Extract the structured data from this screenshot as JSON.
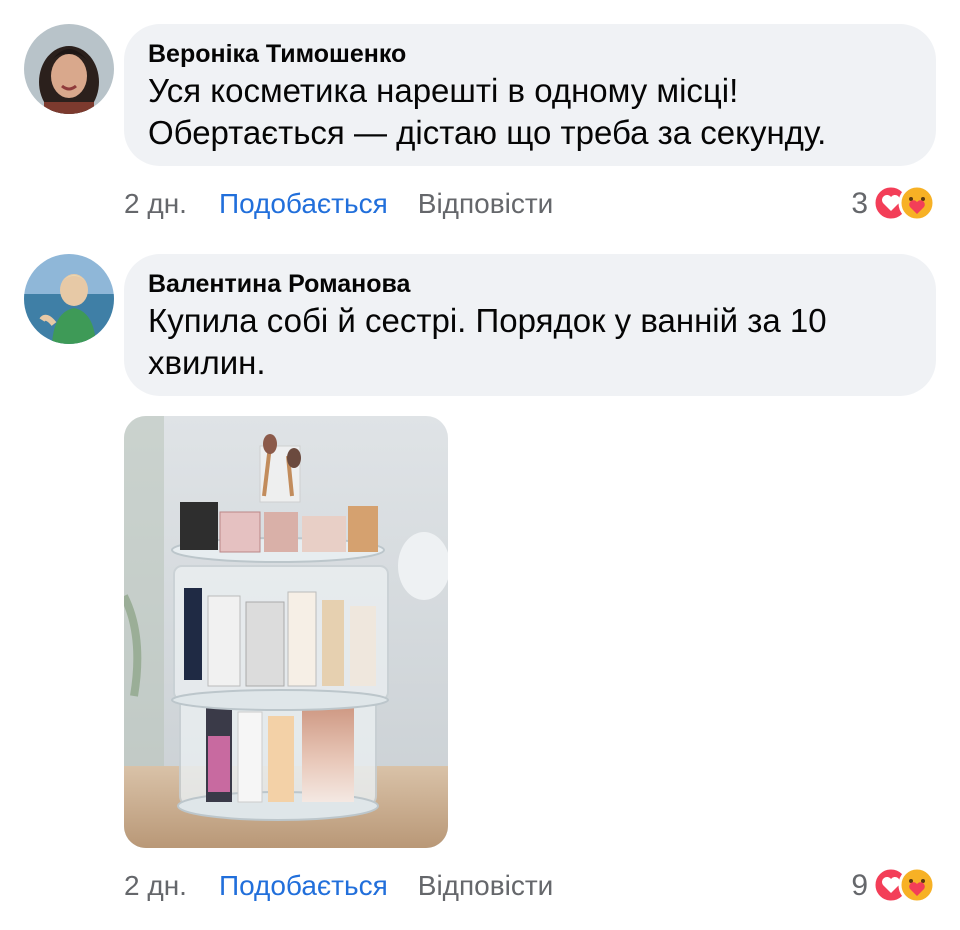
{
  "comments": [
    {
      "author": "Вероніка Тимошенко",
      "text_lines": [
        "Уся косметика нарешті в одному місці!",
        "Обертається — дістаю що треба за секунду."
      ],
      "time": "2 дн.",
      "like_label": "Подобається",
      "reply_label": "Відповісти",
      "reaction_count": "3",
      "reaction_icons": [
        "love-icon",
        "care-icon"
      ]
    },
    {
      "author": "Валентина Романова",
      "text_lines": [
        "Купила собі й сестрі. Порядок у ванній за 10",
        "хвилин."
      ],
      "time": "2 дн.",
      "like_label": "Подобається",
      "reply_label": "Відповісти",
      "reaction_count": "9",
      "reaction_icons": [
        "love-icon",
        "care-icon"
      ],
      "attachment": "photo of rotating acrylic cosmetics organizer"
    }
  ],
  "colors": {
    "bubble": "#f0f2f5",
    "link": "#216fdb",
    "meta": "#65676b",
    "love": "#f33e58",
    "care": "#f7b125"
  }
}
